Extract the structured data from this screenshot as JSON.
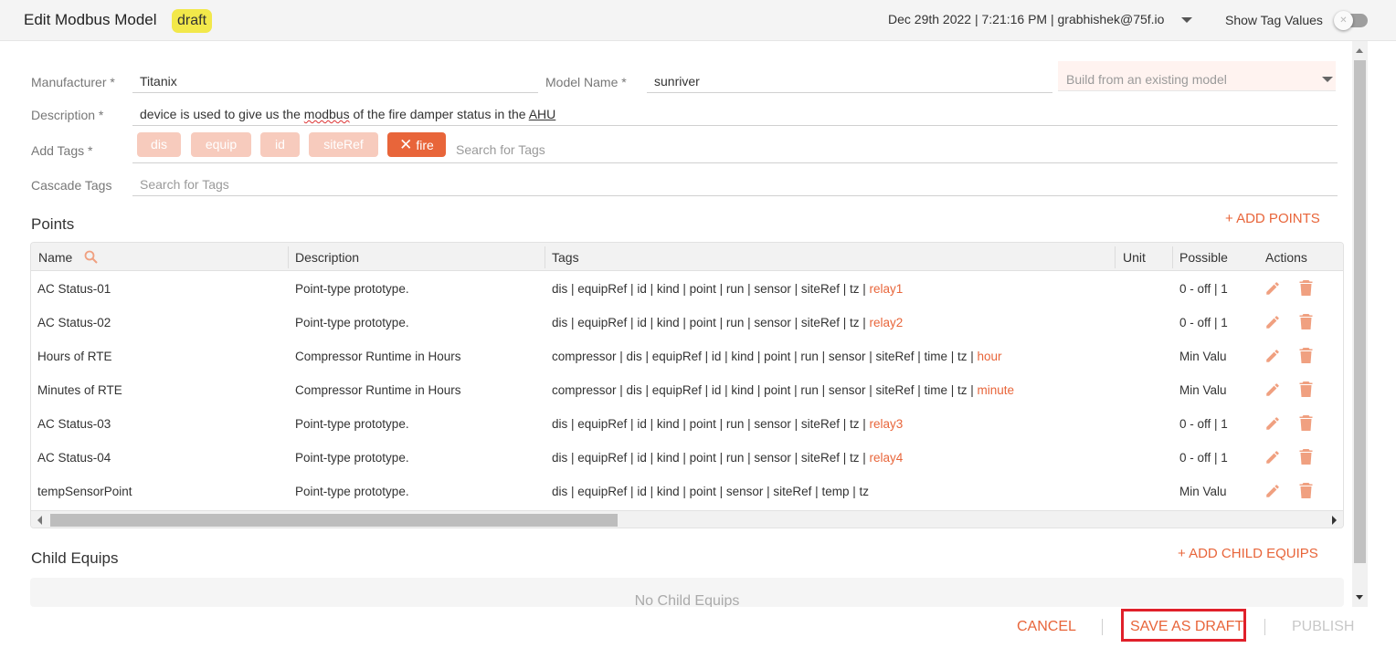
{
  "header": {
    "title": "Edit Modbus Model",
    "status_badge": "draft",
    "meta": "Dec 29th 2022 | 7:21:16 PM | grabhishek@75f.io",
    "show_tag_values_label": "Show Tag Values",
    "show_tag_values": false
  },
  "form": {
    "manufacturer_label": "Manufacturer *",
    "manufacturer_value": "Titanix",
    "model_name_label": "Model Name *",
    "model_name_value": "sunriver",
    "build_from_placeholder": "Build from an existing model",
    "description_label": "Description *",
    "description_parts": {
      "a": "device is used to give us the ",
      "b": "modbus",
      "c": " of the fire damper status in the ",
      "d": "AHU"
    },
    "add_tags_label": "Add Tags *",
    "tags": [
      "dis",
      "equip",
      "id",
      "siteRef",
      "fire"
    ],
    "tag_search_placeholder": "Search for Tags",
    "cascade_tags_label": "Cascade Tags",
    "cascade_search_placeholder": "Search for Tags"
  },
  "points": {
    "title": "Points",
    "add_label": "+ ADD POINTS",
    "columns": [
      "Name",
      "Description",
      "Tags",
      "Unit",
      "Possible",
      "Actions"
    ],
    "rows": [
      {
        "name": "AC Status-01",
        "description": "Point-type prototype.",
        "tags": "dis | equipRef | id | kind | point | run | sensor | siteRef | tz | ",
        "tag_highlight": "relay1",
        "unit": "",
        "possible": "0 - off | 1"
      },
      {
        "name": "AC Status-02",
        "description": "Point-type prototype.",
        "tags": "dis | equipRef | id | kind | point | run | sensor | siteRef | tz | ",
        "tag_highlight": "relay2",
        "unit": "",
        "possible": "0 - off | 1"
      },
      {
        "name": "Hours of RTE",
        "description": "Compressor Runtime in Hours",
        "tags": "compressor | dis | equipRef | id | kind | point | run | sensor | siteRef | time | tz | ",
        "tag_highlight": "hour",
        "unit": "",
        "possible": "Min Valu"
      },
      {
        "name": "Minutes of RTE",
        "description": "Compressor Runtime in Hours",
        "tags": "compressor | dis | equipRef | id | kind | point | run | sensor | siteRef | time | tz | ",
        "tag_highlight": "minute",
        "unit": "",
        "possible": "Min Valu"
      },
      {
        "name": "AC Status-03",
        "description": "Point-type prototype.",
        "tags": "dis | equipRef | id | kind | point | run | sensor | siteRef | tz | ",
        "tag_highlight": "relay3",
        "unit": "",
        "possible": "0 - off | 1"
      },
      {
        "name": "AC Status-04",
        "description": "Point-type prototype.",
        "tags": "dis | equipRef | id | kind | point | run | sensor | siteRef | tz | ",
        "tag_highlight": "relay4",
        "unit": "",
        "possible": "0 - off | 1"
      },
      {
        "name": "tempSensorPoint",
        "description": "Point-type prototype.",
        "tags": "dis | equipRef | id | kind | point | sensor | siteRef | temp | tz",
        "tag_highlight": "",
        "unit": "",
        "possible": "Min Valu"
      }
    ]
  },
  "child_equips": {
    "title": "Child Equips",
    "add_label": "+ ADD CHILD EQUIPS",
    "empty_text": "No Child Equips"
  },
  "footer": {
    "cancel": "CANCEL",
    "save_draft": "SAVE AS DRAFT",
    "publish": "PUBLISH"
  },
  "colors": {
    "accent": "#e8653a",
    "chip_inactive": "#f7cbbd",
    "badge": "#f2e84a",
    "highlight_box": "#e0202a"
  }
}
